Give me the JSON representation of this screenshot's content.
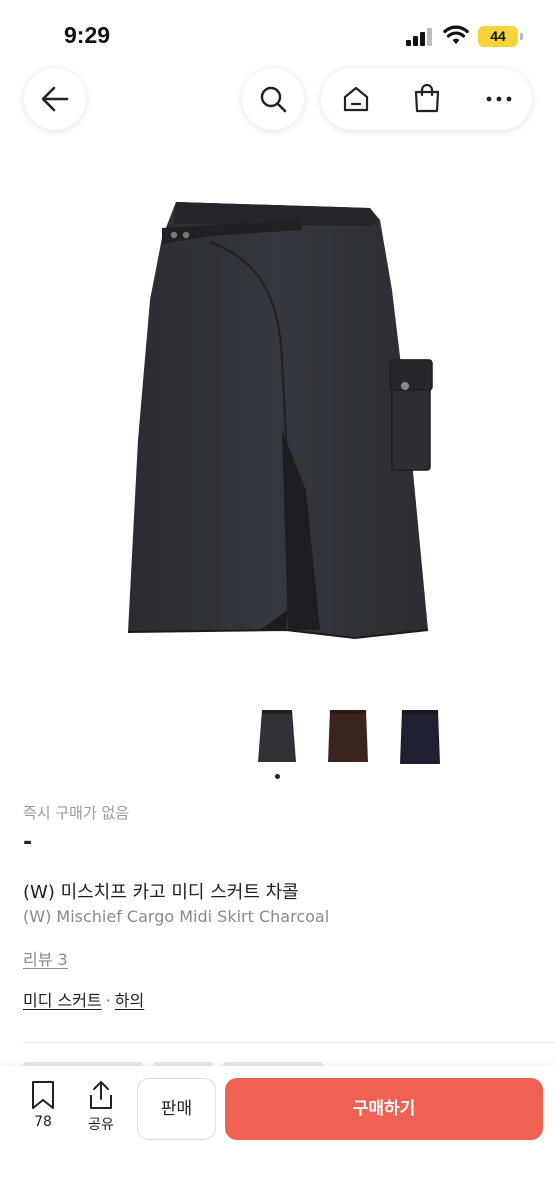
{
  "status_bar": {
    "time": "9:29",
    "battery": "44"
  },
  "nav": {
    "back_icon": "arrow-left-icon",
    "search_icon": "search-icon",
    "home_icon": "home-icon",
    "bag_icon": "shopping-bag-icon",
    "more_icon": "more-horizontal-icon"
  },
  "product": {
    "image_alt": "charcoal-midi-skirt-image",
    "thumbnails": [
      {
        "name": "charcoal",
        "color": "#2f3136"
      },
      {
        "name": "brown",
        "color": "#3a251e"
      },
      {
        "name": "navy",
        "color": "#1e2230"
      }
    ],
    "selected_thumbnail": 0,
    "instant_buy_label": "즉시 구매가 없음",
    "price": "-",
    "title_ko": "(W) 미스치프 카고 미디 스커트 차콜",
    "title_en": "(W) Mischief Cargo Midi Skirt Charcoal",
    "review_link": "리뷰 3",
    "category_1": "미디 스커트",
    "category_separator": "·",
    "category_2": "하의"
  },
  "bottom_bar": {
    "bookmark_count": "78",
    "share_label": "공유",
    "sell_label": "판매",
    "buy_label": "구매하기"
  },
  "colors": {
    "accent": "#ef6253",
    "muted_text": "#8a8a8a"
  }
}
